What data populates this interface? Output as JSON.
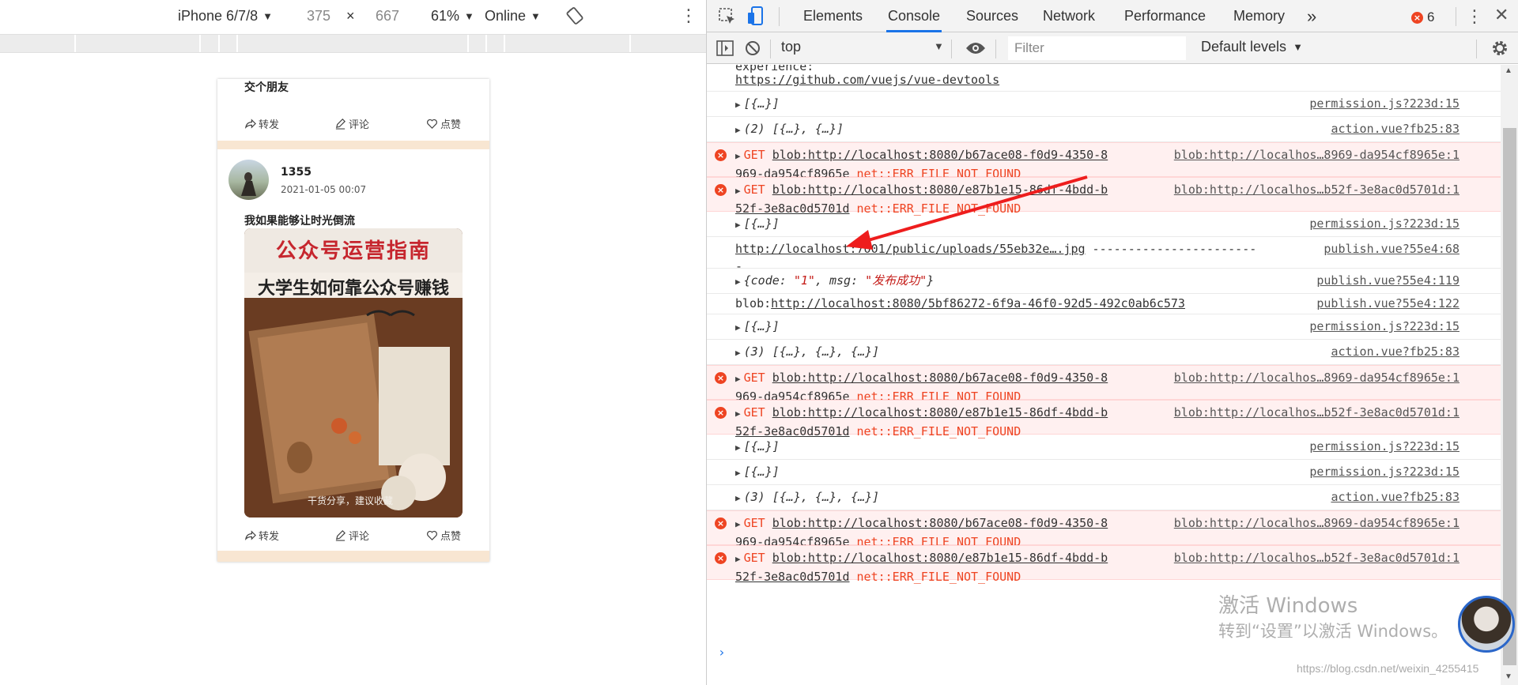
{
  "device_toolbar": {
    "device": "iPhone 6/7/8",
    "width": "375",
    "times": "×",
    "height": "667",
    "zoom": "61%",
    "network": "Online"
  },
  "phone": {
    "post1_text": "交个朋友",
    "share_label": "转发",
    "comment_label": "评论",
    "like_label": "点赞",
    "post2": {
      "username": "1355",
      "datetime": "2021-01-05 00:07",
      "text": "我如果能够让时光倒流",
      "image_title": "公众号运营指南",
      "image_subtitle": "大学生如何靠公众号赚钱",
      "image_caption": "干货分享，建议收藏"
    }
  },
  "devtools": {
    "tabs": [
      "Elements",
      "Console",
      "Sources",
      "Network",
      "Performance",
      "Memory"
    ],
    "active_tab": "Console",
    "more_tabs": "»",
    "error_count": "6",
    "context": "top",
    "filter_placeholder": "Filter",
    "levels": "Default levels",
    "accent_color": "#1a73e8",
    "error_color": "#e42222"
  },
  "console": {
    "top_text": "experience:",
    "top_link": "https://github.com/vuejs/vue-devtools",
    "rows": [
      {
        "type": "log",
        "msg": "[{…}]",
        "src": "permission.js?223d:15"
      },
      {
        "type": "log",
        "msg": "(2) [{…}, {…}]",
        "src": "action.vue?fb25:83"
      },
      {
        "type": "error",
        "url1": "blob:http://localhost:8080/b67ace08-f0d9-4350-8",
        "src": "blob:http://localhos…8969-da954cf8965e:1",
        "url2": "969-da954cf8965e",
        "err": "net::ERR_FILE_NOT_FOUND"
      },
      {
        "type": "error",
        "url1": "blob:http://localhost:8080/e87b1e15-86df-4bdd-b",
        "src": "blob:http://localhos…b52f-3e8ac0d5701d:1",
        "url2": "52f-3e8ac0d5701d",
        "err": "net::ERR_FILE_NOT_FOUND"
      },
      {
        "type": "log",
        "msg": "[{…}]",
        "src": "permission.js?223d:15"
      },
      {
        "type": "plain",
        "link": "http://localhost:7001/public/uploads/55eb32e….jpg",
        "dashes": " -----------------------",
        "cont": "-",
        "src": "publish.vue?55e4:68"
      },
      {
        "type": "obj",
        "code_key": "code",
        "code_val": "\"1\"",
        "msg_key": "msg",
        "msg_val": "\"发布成功\"",
        "src": "publish.vue?55e4:119"
      },
      {
        "type": "blob",
        "prefix": "blob:",
        "link": "http://localhost:8080/5bf86272-6f9a-46f0-92d5-492c0ab6c573",
        "src": "publish.vue?55e4:122"
      },
      {
        "type": "log",
        "msg": "[{…}]",
        "src": "permission.js?223d:15"
      },
      {
        "type": "log",
        "msg": "(3) [{…}, {…}, {…}]",
        "src": "action.vue?fb25:83"
      },
      {
        "type": "error",
        "url1": "blob:http://localhost:8080/b67ace08-f0d9-4350-8",
        "src": "blob:http://localhos…8969-da954cf8965e:1",
        "url2": "969-da954cf8965e",
        "err": "net::ERR_FILE_NOT_FOUND"
      },
      {
        "type": "error",
        "url1": "blob:http://localhost:8080/e87b1e15-86df-4bdd-b",
        "src": "blob:http://localhos…b52f-3e8ac0d5701d:1",
        "url2": "52f-3e8ac0d5701d",
        "err": "net::ERR_FILE_NOT_FOUND"
      },
      {
        "type": "log",
        "msg": "[{…}]",
        "src": "permission.js?223d:15"
      },
      {
        "type": "log",
        "msg": "[{…}]",
        "src": "permission.js?223d:15"
      },
      {
        "type": "log",
        "msg": "(3) [{…}, {…}, {…}]",
        "src": "action.vue?fb25:83"
      },
      {
        "type": "error",
        "url1": "blob:http://localhost:8080/b67ace08-f0d9-4350-8",
        "src": "blob:http://localhos…8969-da954cf8965e:1",
        "url2": "969-da954cf8965e",
        "err": "net::ERR_FILE_NOT_FOUND"
      },
      {
        "type": "error",
        "url1": "blob:http://localhost:8080/e87b1e15-86df-4bdd-b",
        "src": "blob:http://localhos…b52f-3e8ac0d5701d:1",
        "url2": "52f-3e8ac0d5701d",
        "err": "net::ERR_FILE_NOT_FOUND"
      }
    ],
    "get_label": "GET",
    "prompt": "›"
  },
  "overlay": {
    "watermark_line1": "激活 Windows",
    "watermark_line2": "转到“设置”以激活 Windows。",
    "csdn": "https://blog.csdn.net/weixin_4255415"
  }
}
